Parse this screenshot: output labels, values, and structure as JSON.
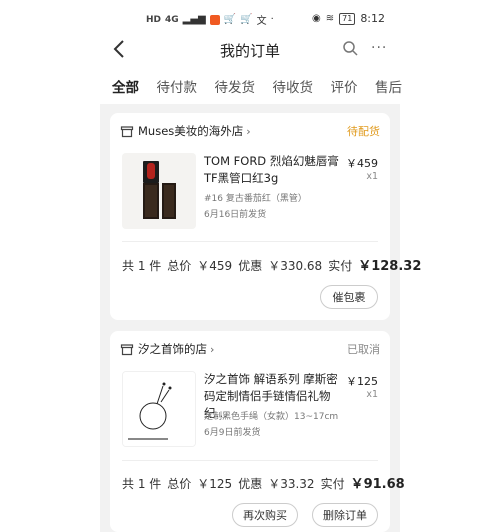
{
  "statusbar": {
    "left_text": "HD",
    "signal": "4G",
    "time": "8:12",
    "battery": "71"
  },
  "nav": {
    "title": "我的订单"
  },
  "tabs": [
    {
      "label": "全部",
      "active": true
    },
    {
      "label": "待付款"
    },
    {
      "label": "待发货"
    },
    {
      "label": "待收货"
    },
    {
      "label": "评价"
    },
    {
      "label": "售后"
    }
  ],
  "orders": [
    {
      "shop": "Muses美妆的海外店",
      "status": "待配货",
      "status_color": "#e09a1c",
      "product_title": "TOM FORD 烈焰幻魅唇膏 TF黑管口红3g",
      "price": "￥459",
      "qty": "x1",
      "spec": "#16 复古番茄红（黑管）",
      "ship": "6月16日前发货",
      "summary": {
        "count": "共 1 件",
        "total_label": "总价",
        "total": "￥459",
        "discount_label": "优惠",
        "discount": "￥330.68",
        "paid_label": "实付",
        "paid": "￥128.32"
      },
      "buttons": [
        "催包裹"
      ]
    },
    {
      "shop": "汐之首饰的店",
      "status": "已取消",
      "status_color": "#888888",
      "product_title": "汐之首饰 解语系列 摩斯密码定制情侣手链情侣礼物纪…",
      "price": "￥125",
      "qty": "x1",
      "spec": "定制黑色手绳（女款）13~17cm",
      "ship": "6月9日前发货",
      "summary": {
        "count": "共 1 件",
        "total_label": "总价",
        "total": "￥125",
        "discount_label": "优惠",
        "discount": "￥33.32",
        "paid_label": "实付",
        "paid": "￥91.68"
      },
      "buttons": [
        "再次购买",
        "删除订单"
      ]
    }
  ],
  "colors": {
    "accent": "#e02e24",
    "pending": "#e09a1c",
    "cancelled": "#888888"
  }
}
